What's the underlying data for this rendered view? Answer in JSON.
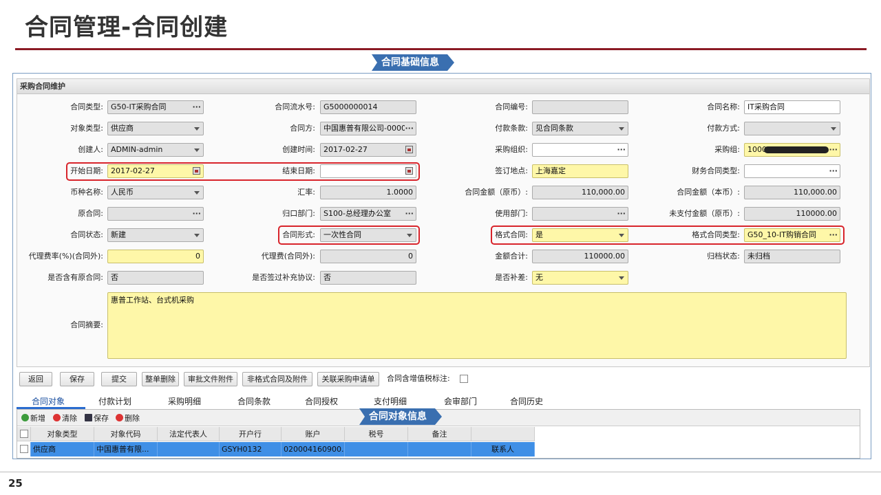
{
  "slide_title": "合同管理-合同创建",
  "banner_top": "合同基础信息",
  "banner_bottom": "合同对象信息",
  "panel_title": "采购合同维护",
  "page_number": "25",
  "form": {
    "r1": {
      "l1": "合同类型:",
      "v1": "G50-IT采购合同",
      "l2": "合同流水号:",
      "v2": "G5000000014",
      "l3": "合同编号:",
      "v3": "",
      "l4": "合同名称:",
      "v4": "IT采购合同"
    },
    "r2": {
      "l1": "对象类型:",
      "v1": "供应商",
      "l2": "合同方:",
      "v2": "中国惠普有限公司-0000",
      "l3": "付款条款:",
      "v3": "见合同条款",
      "l4": "付款方式:",
      "v4": ""
    },
    "r3": {
      "l1": "创建人:",
      "v1": "ADMIN-admin",
      "l2": "创建时间:",
      "v2": "2017-02-27",
      "l3": "采购组织:",
      "v3": "",
      "l4": "采购组:",
      "v4": "1000"
    },
    "r4": {
      "l1": "开始日期:",
      "v1": "2017-02-27",
      "l2": "结束日期:",
      "v2": "",
      "l3": "签订地点:",
      "v3": "上海嘉定",
      "l4": "财务合同类型:",
      "v4": ""
    },
    "r5": {
      "l1": "币种名称:",
      "v1": "人民币",
      "l2": "汇率:",
      "v2": "1.0000",
      "l3": "合同金额（原币）:",
      "v3": "110,000.00",
      "l4": "合同金额（本币）:",
      "v4": "110,000.00"
    },
    "r6": {
      "l1": "原合同:",
      "v1": "",
      "l2": "归口部门:",
      "v2": "S100-总经理办公室",
      "l3": "使用部门:",
      "v3": "",
      "l4": "未支付金额（原币）:",
      "v4": "110000.00"
    },
    "r7": {
      "l1": "合同状态:",
      "v1": "新建",
      "l2": "合同形式:",
      "v2": "一次性合同",
      "l3": "格式合同:",
      "v3": "是",
      "l4": "格式合同类型:",
      "v4": "G50_10-IT购销合同"
    },
    "r8": {
      "l1": "代理费率(%)(合同外):",
      "v1": "0",
      "l2": "代理费(合同外):",
      "v2": "0",
      "l3": "金额合计:",
      "v3": "110000.00",
      "l4": "归档状态:",
      "v4": "未归档"
    },
    "r9": {
      "l1": "是否含有原合同:",
      "v1": "否",
      "l2": "是否签过补充协议:",
      "v2": "否",
      "l3": "是否补差:",
      "v3": "无"
    },
    "summary_label": "合同摘要:",
    "summary_value": "惠普工作站、台式机采购"
  },
  "buttons": [
    "返回",
    "保存",
    "提交",
    "整单删除",
    "审批文件附件",
    "非格式合同及附件",
    "关联采购申请单"
  ],
  "vat_label": "合同含增值税标注:",
  "tabs": [
    "合同对象",
    "付款计划",
    "采购明细",
    "合同条款",
    "合同授权",
    "支付明细",
    "会审部门",
    "合同历史"
  ],
  "grid_toolbar": {
    "add": "新增",
    "clear": "清除",
    "save": "保存",
    "delete": "删除"
  },
  "grid_columns": [
    "对象类型",
    "对象代码",
    "法定代表人",
    "开户行",
    "账户",
    "税号",
    "备注",
    ""
  ],
  "grid_row": [
    "供应商",
    "中国惠普有限...",
    "",
    "GSYH0132",
    "020004160900...",
    "",
    "",
    "联系人"
  ],
  "colors": {
    "title_rule": "#8b1a24",
    "banner": "#3a6fb0",
    "highlight": "#d8232a",
    "required_field": "#fef7a8",
    "selected_row": "#3f8fe6"
  }
}
